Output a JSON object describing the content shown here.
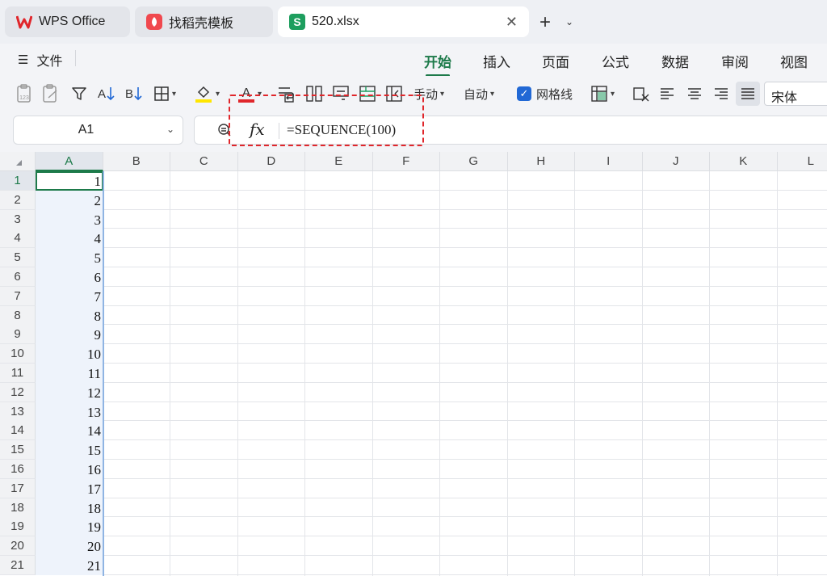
{
  "tabs": [
    {
      "label": "WPS Office",
      "icon": "wps-logo-icon",
      "state": "inactive"
    },
    {
      "label": "找稻壳模板",
      "icon": "docer-logo-icon",
      "state": "inactive"
    },
    {
      "label": "520.xlsx",
      "icon": "spreadsheet-s-icon",
      "state": "active"
    }
  ],
  "tab_actions": {
    "close": "✕",
    "new": "+",
    "more": "⌄"
  },
  "menu": {
    "file": "文件",
    "tabs": [
      "开始",
      "插入",
      "页面",
      "公式",
      "数据",
      "审阅",
      "视图"
    ],
    "active_tab": "开始"
  },
  "toolbar": {
    "row_height_mode": "手动",
    "col_width_mode": "自动",
    "gridlines_label": "网格线",
    "gridlines_checked": true,
    "font_name": "宋体",
    "fill_color": "#ffe600",
    "font_color": "#e0262b"
  },
  "formula_bar": {
    "name_box": "A1",
    "fx_label": "fx",
    "formula": "=SEQUENCE(100)"
  },
  "sheet": {
    "columns": [
      "A",
      "B",
      "C",
      "D",
      "E",
      "F",
      "G",
      "H",
      "I",
      "J",
      "K",
      "L"
    ],
    "rows": [
      "1",
      "2",
      "3",
      "4",
      "5",
      "6",
      "7",
      "8",
      "9",
      "10",
      "11",
      "12",
      "13",
      "14",
      "15",
      "16",
      "17",
      "18",
      "19",
      "20",
      "21"
    ],
    "colA_values": [
      "1",
      "2",
      "3",
      "4",
      "5",
      "6",
      "7",
      "8",
      "9",
      "10",
      "11",
      "12",
      "13",
      "14",
      "15",
      "16",
      "17",
      "18",
      "19",
      "20",
      "21"
    ],
    "selected_cell": "A1"
  },
  "colors": {
    "accent": "#1d7a4a",
    "highlight_box": "#e0262b",
    "checkbox": "#2168d5"
  }
}
